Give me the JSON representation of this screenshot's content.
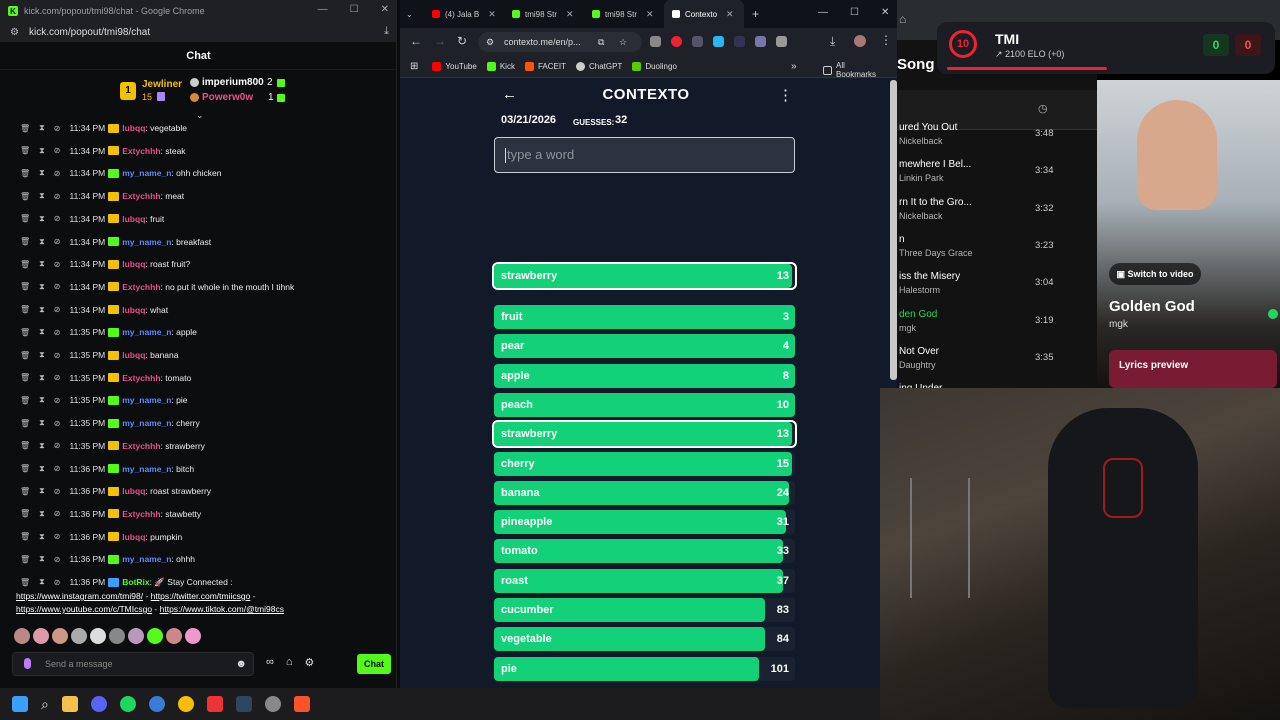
{
  "kick": {
    "window_title": "kick.com/popout/tmi98/chat - Google Chrome",
    "url": "kick.com/popout/tmi98/chat",
    "chat_header": "Chat",
    "gifter1": {
      "name": "Jewliner",
      "count": "15",
      "rank": "1"
    },
    "gifter2": {
      "name": "imperium800",
      "count": "2"
    },
    "gifter3": {
      "name": "Powerw0w",
      "count": "1"
    },
    "messages": [
      {
        "time": "11:34 PM",
        "user": "lubqq",
        "text": ": vegetable",
        "color": "#e84f8a"
      },
      {
        "time": "11:34 PM",
        "user": "Extychhh",
        "text": ": steak",
        "color": "#e84f8a"
      },
      {
        "time": "11:34 PM",
        "user": "my_name_n",
        "text": ": ohh chicken",
        "color": "#5b8cff"
      },
      {
        "time": "11:34 PM",
        "user": "Extychhh",
        "text": ": meat",
        "color": "#e84f8a"
      },
      {
        "time": "11:34 PM",
        "user": "lubqq",
        "text": ": fruit",
        "color": "#e84f8a"
      },
      {
        "time": "11:34 PM",
        "user": "my_name_n",
        "text": ": breakfast",
        "color": "#5b8cff"
      },
      {
        "time": "11:34 PM",
        "user": "lubqq",
        "text": ": roast fruit?",
        "color": "#e84f8a"
      },
      {
        "time": "11:34 PM",
        "user": "Extychhh",
        "text": ": no put it whole in the mouth I tihnk",
        "color": "#e84f8a"
      },
      {
        "time": "11:34 PM",
        "user": "lubqq",
        "text": ": what",
        "color": "#e84f8a"
      },
      {
        "time": "11:35 PM",
        "user": "my_name_n",
        "text": ": apple",
        "color": "#5b8cff"
      },
      {
        "time": "11:35 PM",
        "user": "lubqq",
        "text": ": banana",
        "color": "#e84f8a"
      },
      {
        "time": "11:35 PM",
        "user": "Extychhh",
        "text": ": tomato",
        "color": "#e84f8a"
      },
      {
        "time": "11:35 PM",
        "user": "my_name_n",
        "text": ": pie",
        "color": "#5b8cff"
      },
      {
        "time": "11:35 PM",
        "user": "my_name_n",
        "text": ": cherry",
        "color": "#5b8cff"
      },
      {
        "time": "11:35 PM",
        "user": "Extychhh",
        "text": ": strawberry",
        "color": "#e84f8a"
      },
      {
        "time": "11:36 PM",
        "user": "my_name_n",
        "text": ": bitch",
        "color": "#5b8cff"
      },
      {
        "time": "11:36 PM",
        "user": "lubqq",
        "text": ": roast strawberry",
        "color": "#e84f8a"
      },
      {
        "time": "11:36 PM",
        "user": "Extychhh",
        "text": ": stawbetty",
        "color": "#e84f8a"
      },
      {
        "time": "11:36 PM",
        "user": "lubqq",
        "text": ": pumpkin",
        "color": "#e84f8a"
      },
      {
        "time": "11:36 PM",
        "user": "my_name_n",
        "text": ": ohhh",
        "color": "#5b8cff"
      },
      {
        "time": "11:36 PM",
        "user": "BotRix",
        "text": ": 🚀 Stay Connected :",
        "color": "#53fc18"
      }
    ],
    "bot_links": {
      "l1": "https://www.instagram.com/tmi98/",
      "l2": "https://twitter.com/tmiicsgo",
      "l3": "https://www.youtube.com/c/TMIcsgo",
      "l4": "https://www.tiktok.com/@tmi98cs"
    },
    "send_placeholder": "Send a message",
    "chat_button": "Chat"
  },
  "chrome": {
    "tabs": [
      {
        "label": "(4) Jala B",
        "color": "#ff0000"
      },
      {
        "label": "tmi98 Str",
        "color": "#53fc18"
      },
      {
        "label": "tmi98 Str",
        "color": "#53fc18"
      },
      {
        "label": "Contexto",
        "color": "#ffffff"
      }
    ],
    "url": "contexto.me/en/p...",
    "bookmarks": [
      "YouTube",
      "Kick",
      "FACEIT",
      "ChatGPT",
      "Duolingo"
    ],
    "all_bookmarks": "All Bookmarks"
  },
  "contexto": {
    "title": "CONTEXTO",
    "date": "03/21/2026",
    "guesses_label": "GUESSES:",
    "guesses": "32",
    "input_placeholder": "type a word",
    "last_guess": {
      "word": "strawberry",
      "rank": "13",
      "fill": 0.99
    },
    "guesses_list": [
      {
        "word": "fruit",
        "rank": "3",
        "fill": 1.0
      },
      {
        "word": "pear",
        "rank": "4",
        "fill": 1.0
      },
      {
        "word": "apple",
        "rank": "8",
        "fill": 1.0
      },
      {
        "word": "peach",
        "rank": "10",
        "fill": 1.0
      },
      {
        "word": "strawberry",
        "rank": "13",
        "fill": 0.99
      },
      {
        "word": "cherry",
        "rank": "15",
        "fill": 0.99
      },
      {
        "word": "banana",
        "rank": "24",
        "fill": 0.98
      },
      {
        "word": "pineapple",
        "rank": "31",
        "fill": 0.97
      },
      {
        "word": "tomato",
        "rank": "33",
        "fill": 0.96
      },
      {
        "word": "roast",
        "rank": "37",
        "fill": 0.96
      },
      {
        "word": "cucumber",
        "rank": "83",
        "fill": 0.9
      },
      {
        "word": "vegetable",
        "rank": "84",
        "fill": 0.9
      },
      {
        "word": "pie",
        "rank": "101",
        "fill": 0.88
      }
    ]
  },
  "overlay": {
    "name": "TMI",
    "elo": "2100 ELO (+0)",
    "level": "10",
    "wins": "0",
    "losses": "0"
  },
  "spotify": {
    "header": "Song",
    "songs": [
      {
        "title": "ured You Out",
        "artist": "Nickelback",
        "duration": "3:48"
      },
      {
        "title": "mewhere I Bel...",
        "artist": "Linkin Park",
        "duration": "3:34"
      },
      {
        "title": "rn It to the Gro...",
        "artist": "Nickelback",
        "duration": "3:32"
      },
      {
        "title": "n",
        "artist": "Three Days Grace",
        "duration": "3:23"
      },
      {
        "title": "iss the Misery",
        "artist": "Halestorm",
        "duration": "3:04"
      },
      {
        "title": "den God",
        "artist": "mgk",
        "duration": "3:19"
      },
      {
        "title": "Not Over",
        "artist": "Daughtry",
        "duration": "3:35"
      },
      {
        "title": "ing Under",
        "artist": "",
        "duration": ""
      }
    ],
    "switch_video": "Switch to video",
    "now_title": "Golden God",
    "now_artist": "mgk",
    "lyrics": "Lyrics preview"
  }
}
